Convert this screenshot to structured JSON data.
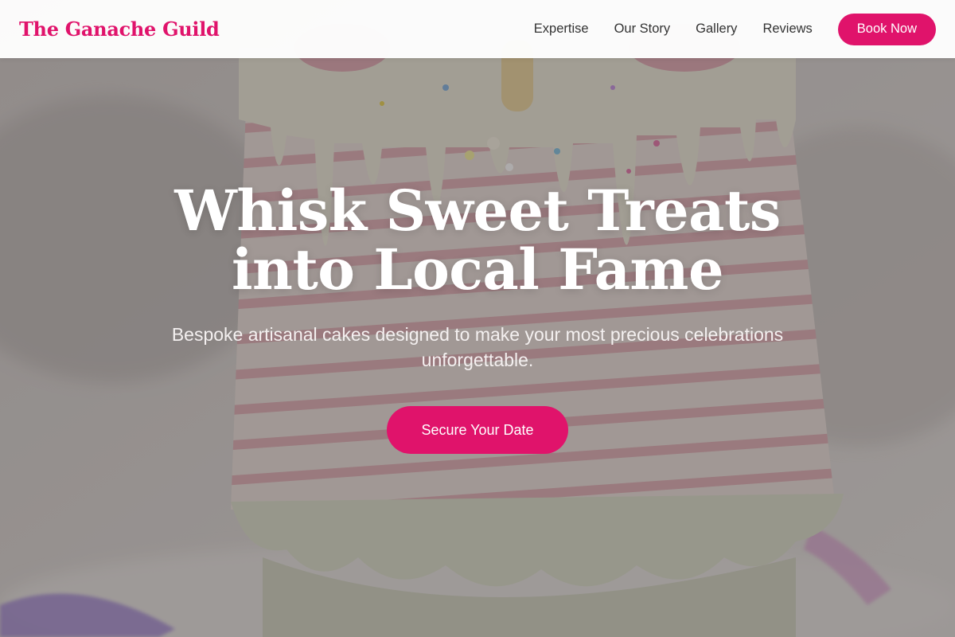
{
  "brand": {
    "name": "The Ganache Guild"
  },
  "nav": {
    "links": [
      "Expertise",
      "Our Story",
      "Gallery",
      "Reviews"
    ],
    "cta_label": "Book Now"
  },
  "hero": {
    "title": "Whisk Sweet Treats into Local Fame",
    "subtitle": "Bespoke artisanal cakes designed to make your most precious celebrations unforgettable.",
    "cta_label": "Secure Your Date",
    "background": "cake-photo"
  },
  "colors": {
    "accent": "#e0136b",
    "nav_text": "#333333",
    "hero_text": "#ffffff"
  }
}
